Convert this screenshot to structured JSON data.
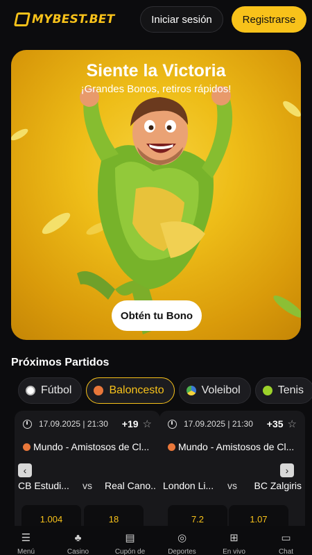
{
  "header": {
    "logo_text": "MYBEST.BET",
    "login_label": "Iniciar sesión",
    "register_label": "Registrarse"
  },
  "banner": {
    "title": "Siente la Victoria",
    "subtitle": "¡Grandes Bonos, retiros rápidos!",
    "cta_label": "Obtén tu Bono"
  },
  "section": {
    "title": "Próximos Partidos"
  },
  "sport_tabs": [
    {
      "label": "Fútbol",
      "icon": "soccer-ball-icon",
      "color": "#ffffff"
    },
    {
      "label": "Baloncesto",
      "icon": "basketball-icon",
      "color": "#e9773a"
    },
    {
      "label": "Voleibol",
      "icon": "volleyball-icon",
      "color": "#3c7ad8"
    },
    {
      "label": "Tenis",
      "icon": "tennis-ball-icon",
      "color": "#9cd22b"
    }
  ],
  "matches": [
    {
      "datetime": "17.09.2025 | 21:30",
      "more_markets": "+19",
      "league": "Mundo - Amistosos de Cl...",
      "home": "CB Estudi...",
      "vs": "vs",
      "away": "Real Cano...",
      "odds": [
        "1.004",
        "18"
      ]
    },
    {
      "datetime": "17.09.2025 | 21:30",
      "more_markets": "+35",
      "league": "Mundo - Amistosos de Cl...",
      "home": "London Li...",
      "vs": "vs",
      "away": "BC Zalgiris",
      "odds": [
        "7.2",
        "1.07"
      ]
    }
  ],
  "bottom_nav": [
    {
      "label": "Menú",
      "icon": "menu-icon"
    },
    {
      "label": "Casino",
      "icon": "casino-icon"
    },
    {
      "label": "Cupón de",
      "icon": "coupon-icon"
    },
    {
      "label": "Deportes",
      "icon": "sports-icon"
    },
    {
      "label": "En vivo",
      "icon": "live-icon"
    },
    {
      "label": "Chat",
      "icon": "chat-icon"
    }
  ],
  "colors": {
    "accent": "#f8c21a",
    "background": "#0c0c0e",
    "card": "#18181b"
  }
}
